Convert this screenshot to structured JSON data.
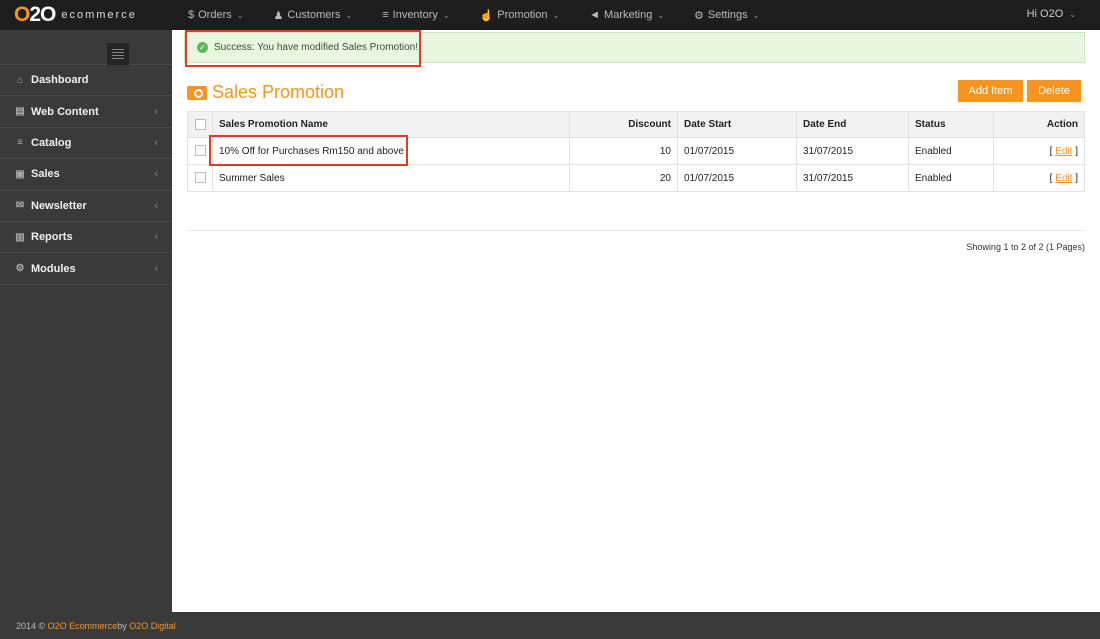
{
  "brand": {
    "logo_o1": "O",
    "logo_2": "2",
    "logo_o2": "O",
    "logo_text": "ecommerce"
  },
  "topnav": [
    {
      "icon": "dollar-icon",
      "glyph": "$",
      "label": "Orders"
    },
    {
      "icon": "user-icon",
      "glyph": "♟",
      "label": "Customers"
    },
    {
      "icon": "cart-icon",
      "glyph": "≡",
      "label": "Inventory"
    },
    {
      "icon": "thumbs-up-icon",
      "glyph": "☝",
      "label": "Promotion"
    },
    {
      "icon": "bullhorn-icon",
      "glyph": "◄",
      "label": "Marketing"
    },
    {
      "icon": "gears-icon",
      "glyph": "⚙",
      "label": "Settings"
    }
  ],
  "user_menu": {
    "label": "Hi O2O"
  },
  "sidebar": {
    "items": [
      {
        "icon": "home-icon",
        "glyph": "⌂",
        "label": "Dashboard",
        "chevron": ""
      },
      {
        "icon": "book-icon",
        "glyph": "▤",
        "label": "Web Content",
        "chevron": "‹"
      },
      {
        "icon": "cart-icon",
        "glyph": "≡",
        "label": "Catalog",
        "chevron": "‹"
      },
      {
        "icon": "money-icon",
        "glyph": "▣",
        "label": "Sales",
        "chevron": "‹"
      },
      {
        "icon": "envelope-icon",
        "glyph": "✉",
        "label": "Newsletter",
        "chevron": "‹"
      },
      {
        "icon": "bar-chart-icon",
        "glyph": "▥",
        "label": "Reports",
        "chevron": "‹"
      },
      {
        "icon": "gear-icon",
        "glyph": "⚙",
        "label": "Modules",
        "chevron": "‹"
      }
    ]
  },
  "alert": {
    "message": "Success: You have modified Sales Promotion!",
    "icon_glyph": "✓"
  },
  "page": {
    "title": "Sales Promotion"
  },
  "buttons": {
    "add": "Add Item",
    "delete": "Delete"
  },
  "table": {
    "headers": {
      "name": "Sales Promotion Name",
      "discount": "Discount",
      "date_start": "Date Start",
      "date_end": "Date End",
      "status": "Status",
      "action": "Action"
    },
    "rows": [
      {
        "name": "10% Off for Purchases Rm150 and above",
        "discount": "10",
        "date_start": "01/07/2015",
        "date_end": "31/07/2015",
        "status": "Enabled",
        "action_open": "[ ",
        "action": "Edit",
        "action_close": " ]"
      },
      {
        "name": "Summer Sales",
        "discount": "20",
        "date_start": "01/07/2015",
        "date_end": "31/07/2015",
        "status": "Enabled",
        "action_open": "[ ",
        "action": "Edit",
        "action_close": " ]"
      }
    ]
  },
  "pagination": {
    "info": "Showing 1 to 2 of 2 (1 Pages)"
  },
  "footer": {
    "year": "2014 © ",
    "company": "O2O Ecommerce",
    "by": " by ",
    "agency": "O2O Digital"
  },
  "colors": {
    "accent": "#f7941d",
    "topbar": "#1e1e1e",
    "sidebar": "#3a3a3a",
    "success_bg": "#e9f6df",
    "highlight": "#e03b24"
  }
}
